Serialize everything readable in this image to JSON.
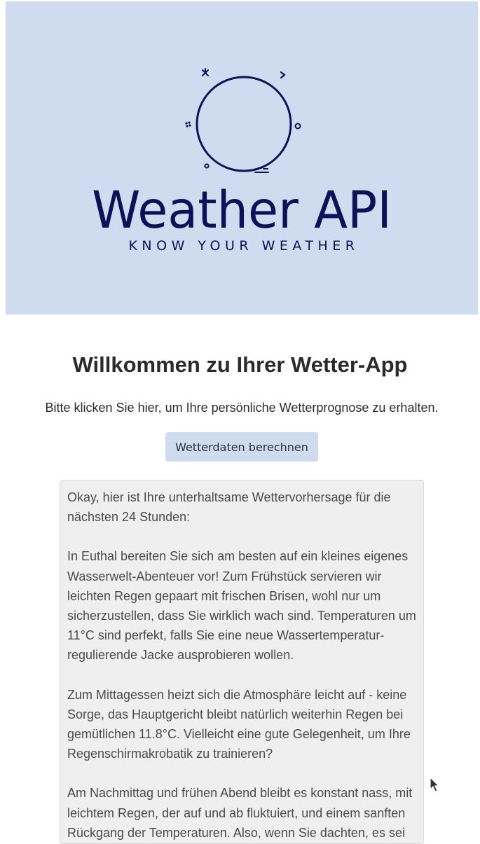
{
  "banner": {
    "logo_title": "Weather API",
    "logo_tagline": "KNOW YOUR WEATHER",
    "logo_icon": "weather-circle-icon",
    "background_color": "#cfdcf0",
    "brand_color": "#0d1257"
  },
  "main": {
    "heading": "Willkommen zu Ihrer Wetter-App",
    "subtext": "Bitte klicken Sie hier, um Ihre persönliche Wetterprognose zu erhalten.",
    "calculate_button_label": "Wetterdaten berechnen"
  },
  "forecast": {
    "paragraphs": [
      "Okay, hier ist Ihre unterhaltsame Wettervorhersage für die nächsten 24 Stunden:",
      "In Euthal bereiten Sie sich am besten auf ein kleines eigenes Wasserwelt-Abenteuer vor! Zum Frühstück servieren wir leichten Regen gepaart mit frischen Brisen, wohl nur um sicherzustellen, dass Sie wirklich wach sind. Temperaturen um 11°C sind perfekt, falls Sie eine neue Wassertemperatur-regulierende Jacke ausprobieren wollen.",
      "Zum Mittagessen heizt sich die Atmosphäre leicht auf - keine Sorge, das Hauptgericht bleibt natürlich weiterhin Regen bei gemütlichen 11.8°C. Vielleicht eine gute Gelegenheit, um Ihre Regenschirmakrobatik zu trainieren?",
      "Am Nachmittag und frühen Abend bleibt es konstant nass, mit leichtem Regen, der auf und ab fluktuiert, und einem sanften Rückgang der Temperaturen. Also, wenn Sie dachten, es sei"
    ]
  }
}
